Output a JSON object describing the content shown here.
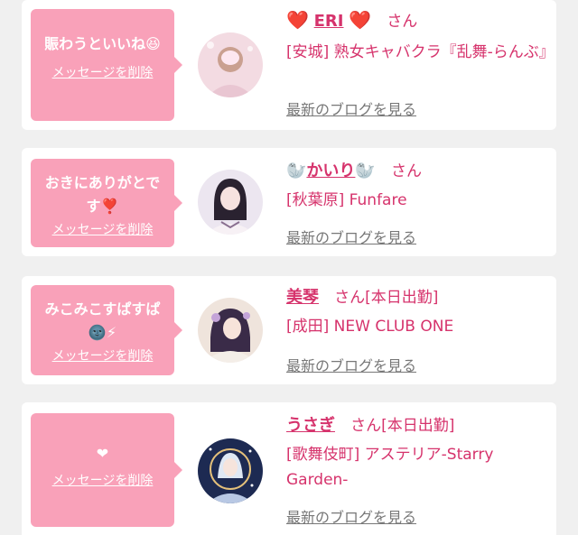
{
  "cards": [
    {
      "message": "賑わうといいね😆",
      "delete_label": "メッセージを削除",
      "name_prefix": "❤️",
      "name": "ERI",
      "name_suffix": "❤️",
      "honorific": "さん",
      "status": "",
      "shop": "[安城] 熟女キャバクラ『乱舞-らんぶ』",
      "blog_link": "最新のブログを見る"
    },
    {
      "message": "おきにありがとです❣️",
      "delete_label": "メッセージを削除",
      "name_prefix": "🦭",
      "name": "かいり",
      "name_suffix": "🦭",
      "honorific": "さん",
      "status": "",
      "shop": "[秋葉原] Funfare",
      "blog_link": "最新のブログを見る"
    },
    {
      "message": "みこみこすぱすぱ🌚⚡",
      "delete_label": "メッセージを削除",
      "name_prefix": "",
      "name": "美琴",
      "name_suffix": "",
      "honorific": "さん",
      "status": "[本日出勤]",
      "shop": "[成田] NEW CLUB ONE",
      "blog_link": "最新のブログを見る"
    },
    {
      "message": "❤",
      "delete_label": "メッセージを削除",
      "name_prefix": "",
      "name": "うさぎ",
      "name_suffix": "",
      "honorific": "さん",
      "status": "[本日出勤]",
      "shop": "[歌舞伎町] アステリア-Starry Garden-",
      "blog_link": "最新のブログを見る"
    }
  ],
  "colors": {
    "bubble": "#f9a1b9",
    "accent": "#d6336c",
    "link_gray": "#777777",
    "background": "#f0f0f0"
  }
}
